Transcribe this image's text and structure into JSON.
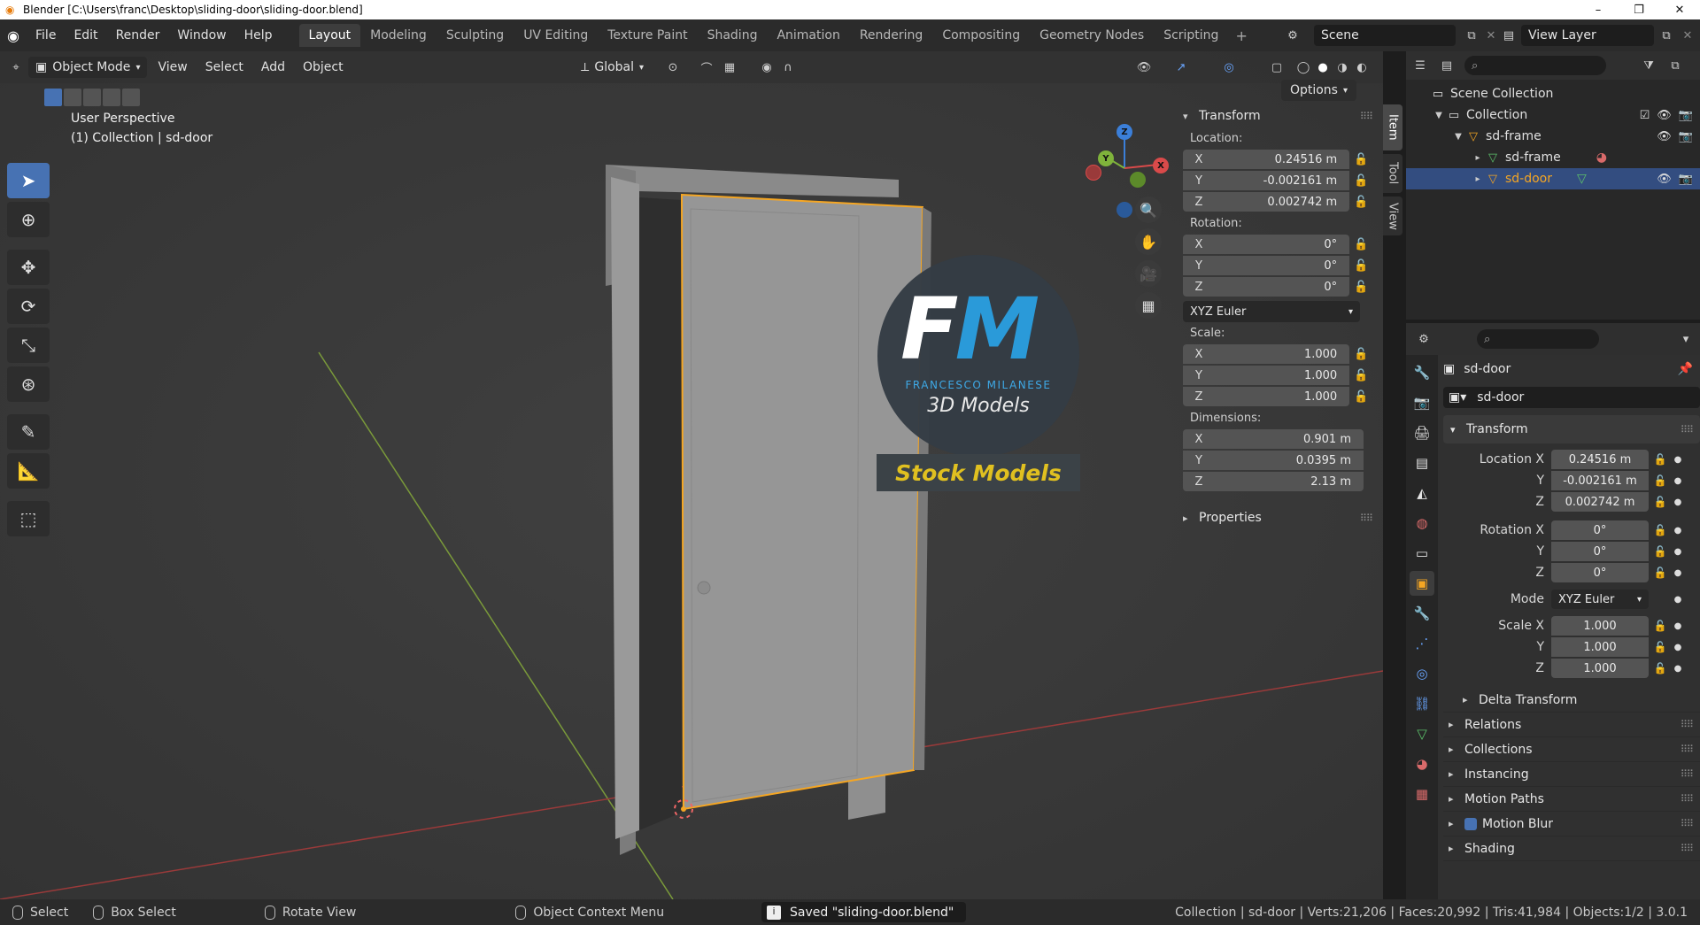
{
  "window": {
    "title": "Blender [C:\\Users\\franc\\Desktop\\sliding-door\\sliding-door.blend]",
    "controls": [
      "–",
      "❐",
      "✕"
    ]
  },
  "menu": [
    "File",
    "Edit",
    "Render",
    "Window",
    "Help"
  ],
  "workspaces": {
    "active": "Layout",
    "tabs": [
      "Layout",
      "Modeling",
      "Sculpting",
      "UV Editing",
      "Texture Paint",
      "Shading",
      "Animation",
      "Rendering",
      "Compositing",
      "Geometry Nodes",
      "Scripting"
    ],
    "add": "+"
  },
  "scene": {
    "name": "Scene",
    "view_layer": "View Layer"
  },
  "viewport": {
    "mode": "Object Mode",
    "menus": [
      "View",
      "Select",
      "Add",
      "Object"
    ],
    "orientation": "Global",
    "overlay_title": "User Perspective",
    "overlay_collection": "(1) Collection | sd-door",
    "options_label": "Options",
    "gizmo": {
      "z": "Z",
      "y": "Y",
      "x": "X"
    }
  },
  "npanel": {
    "transform_header": "Transform",
    "location_label": "Location:",
    "location": [
      {
        "axis": "X",
        "value": "0.24516 m"
      },
      {
        "axis": "Y",
        "value": "-0.002161 m"
      },
      {
        "axis": "Z",
        "value": "0.002742 m"
      }
    ],
    "rotation_label": "Rotation:",
    "rotation": [
      {
        "axis": "X",
        "value": "0°"
      },
      {
        "axis": "Y",
        "value": "0°"
      },
      {
        "axis": "Z",
        "value": "0°"
      }
    ],
    "rotation_mode": "XYZ Euler",
    "scale_label": "Scale:",
    "scale": [
      {
        "axis": "X",
        "value": "1.000"
      },
      {
        "axis": "Y",
        "value": "1.000"
      },
      {
        "axis": "Z",
        "value": "1.000"
      }
    ],
    "dimensions_label": "Dimensions:",
    "dimensions": [
      {
        "axis": "X",
        "value": "0.901 m"
      },
      {
        "axis": "Y",
        "value": "0.0395 m"
      },
      {
        "axis": "Z",
        "value": "2.13 m"
      }
    ],
    "properties_header": "Properties",
    "tabs": [
      "Item",
      "Tool",
      "View"
    ],
    "active_tab": "Item"
  },
  "outliner": {
    "rows": [
      {
        "label": "Scene Collection",
        "indent": 0
      },
      {
        "label": "Collection",
        "indent": 1
      },
      {
        "label": "sd-frame",
        "indent": 2
      },
      {
        "label": "sd-frame",
        "indent": 3
      },
      {
        "label": "sd-door",
        "indent": 3,
        "selected": true
      }
    ]
  },
  "properties": {
    "object_name": "sd-door",
    "data_name": "sd-door",
    "transform_header": "Transform",
    "location": [
      {
        "label": "Location X",
        "value": "0.24516 m"
      },
      {
        "label": "Y",
        "value": "-0.002161 m"
      },
      {
        "label": "Z",
        "value": "0.002742 m"
      }
    ],
    "rotation": [
      {
        "label": "Rotation X",
        "value": "0°"
      },
      {
        "label": "Y",
        "value": "0°"
      },
      {
        "label": "Z",
        "value": "0°"
      }
    ],
    "mode_label": "Mode",
    "mode_value": "XYZ Euler",
    "scale": [
      {
        "label": "Scale X",
        "value": "1.000"
      },
      {
        "label": "Y",
        "value": "1.000"
      },
      {
        "label": "Z",
        "value": "1.000"
      }
    ],
    "delta_transform": "Delta Transform",
    "sections": [
      "Relations",
      "Collections",
      "Instancing",
      "Motion Paths",
      "Motion Blur",
      "Shading"
    ]
  },
  "watermark": {
    "logo_f": "F",
    "logo_m": "M",
    "name": "FRANCESCO MILANESE",
    "subtitle": "3D Models",
    "banner": "Stock Models"
  },
  "statusbar": {
    "select": "Select",
    "box_select": "Box Select",
    "rotate_view": "Rotate View",
    "context_menu": "Object Context Menu",
    "message": "Saved \"sliding-door.blend\"",
    "stats": "Collection | sd-door | Verts:21,206 | Faces:20,992 | Tris:41,984 | Objects:1/2 | 3.0.1"
  },
  "colors": {
    "accent": "#4772b3",
    "selected_outline": "#f5a623",
    "x_axis": "#d94a4a",
    "y_axis": "#7fb33b",
    "z_axis": "#3b7fd9",
    "logo_blue": "#2a9ad9",
    "banner_yellow": "#e0c020"
  }
}
